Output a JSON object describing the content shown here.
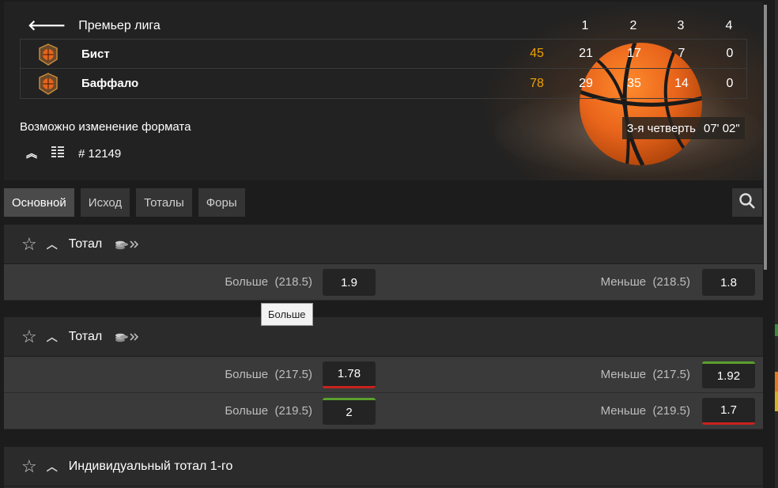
{
  "header": {
    "league": "Премьер лига",
    "period_columns": [
      "1",
      "2",
      "3",
      "4"
    ],
    "teams": [
      {
        "name": "Бист",
        "total": "45",
        "periods": [
          "21",
          "17",
          "7",
          "0"
        ]
      },
      {
        "name": "Баффало",
        "total": "78",
        "periods": [
          "29",
          "35",
          "14",
          "0"
        ]
      }
    ],
    "format_note": "Возможно изменение формата",
    "match_id": "# 12149",
    "period_status": "3-я четверть",
    "clock": "07' 02\""
  },
  "tabs": [
    "Основной",
    "Исход",
    "Тоталы",
    "Форы"
  ],
  "markets": [
    {
      "title": "Тотал",
      "rows": [
        {
          "over_label": "Больше",
          "over_line": "(218.5)",
          "over_odd": "1.9",
          "under_label": "Меньше",
          "under_line": "(218.5)",
          "under_odd": "1.8"
        }
      ]
    },
    {
      "title": "Тотал",
      "rows": [
        {
          "over_label": "Больше",
          "over_line": "(217.5)",
          "over_odd": "1.78",
          "under_label": "Меньше",
          "under_line": "(217.5)",
          "under_odd": "1.92"
        },
        {
          "over_label": "Больше",
          "over_line": "(219.5)",
          "over_odd": "2",
          "under_label": "Меньше",
          "under_line": "(219.5)",
          "under_odd": "1.7"
        }
      ]
    },
    {
      "title": "Индивидуальный тотал 1-го"
    }
  ],
  "tooltip": "Больше",
  "colors": {
    "accent_total": "#f0a100",
    "odd_up": "#5aa02c",
    "odd_down": "#c8221d"
  },
  "icons": [
    "back-arrow-icon",
    "basketball-team-icon",
    "collapse-icon",
    "stats-grid-icon",
    "search-icon",
    "star-icon",
    "caret-up-icon",
    "coins-icon"
  ]
}
